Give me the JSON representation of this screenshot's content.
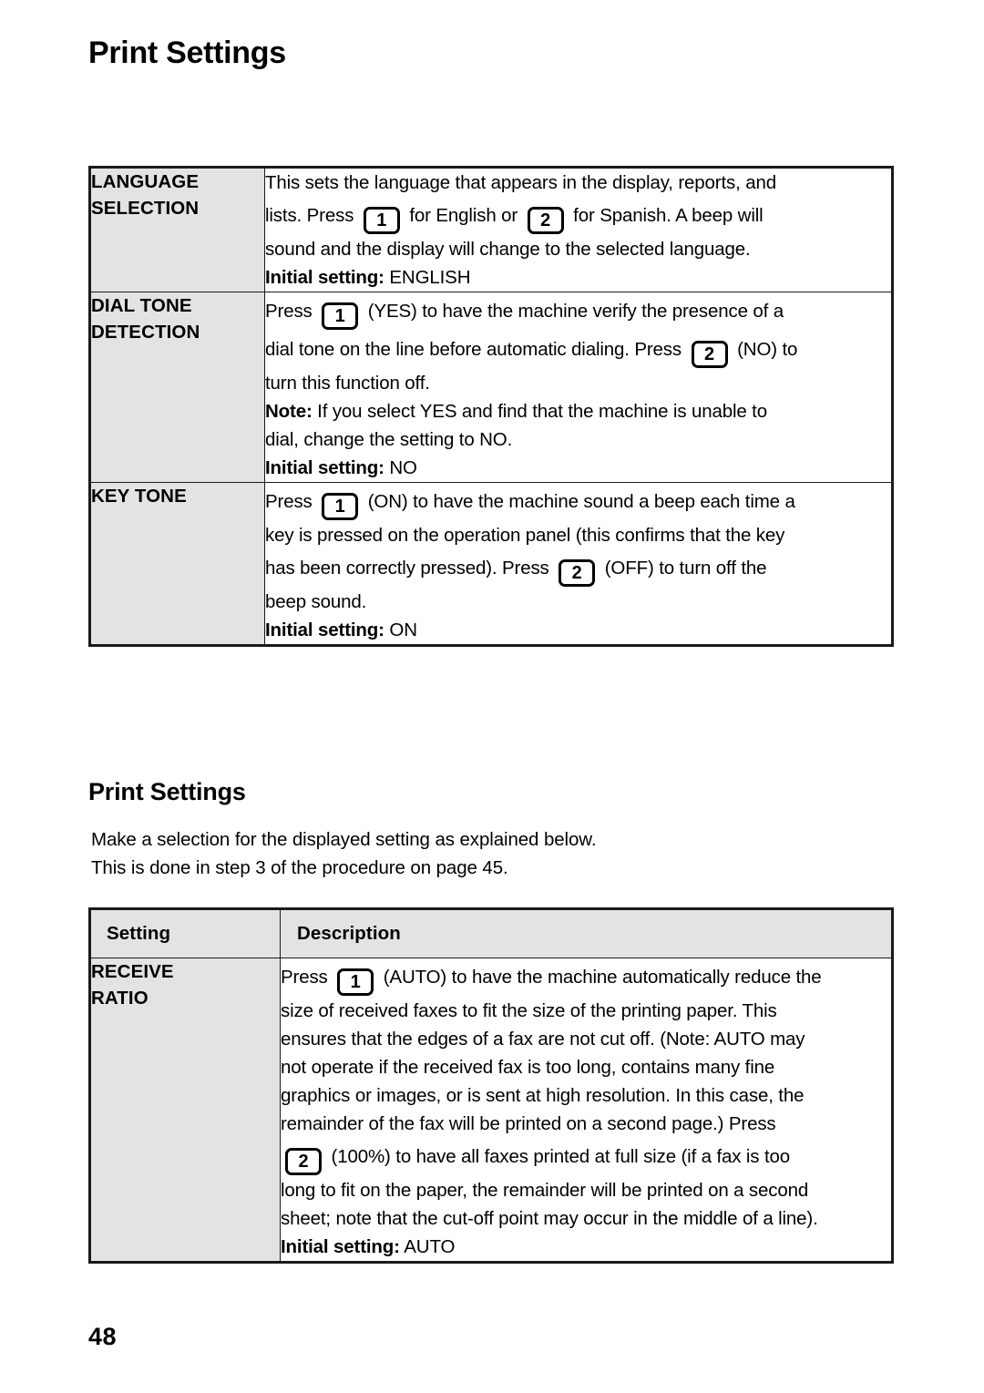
{
  "document": {
    "title": "Print Settings",
    "page_number": "48"
  },
  "settings_table": {
    "rows": [
      {
        "setting_lines": [
          "LANGUAGE",
          "SELECTION"
        ],
        "description_lines": [
          [
            {
              "t": "text",
              "v": "This sets the language that appears in the display, reports, and"
            }
          ],
          [
            {
              "t": "text",
              "v": "lists. Press "
            },
            {
              "t": "key",
              "v": "1"
            },
            {
              "t": "text",
              "v": " for English or "
            },
            {
              "t": "key",
              "v": "2"
            },
            {
              "t": "text",
              "v": " for Spanish. A beep will"
            }
          ],
          [
            {
              "t": "text",
              "v": "sound and the display will change to the selected language."
            }
          ],
          [
            {
              "t": "bold",
              "v": "Initial setting:"
            },
            {
              "t": "text",
              "v": " ENGLISH"
            }
          ]
        ]
      },
      {
        "setting_lines": [
          "DIAL TONE",
          "DETECTION"
        ],
        "description_lines": [
          [
            {
              "t": "text",
              "v": "Press "
            },
            {
              "t": "key",
              "v": "1"
            },
            {
              "t": "text",
              "v": " (YES) to have the machine verify the presence of a"
            }
          ],
          [
            {
              "t": "text",
              "v": "dial tone on the line before automatic dialing. Press "
            },
            {
              "t": "key",
              "v": "2"
            },
            {
              "t": "text",
              "v": " (NO) to"
            }
          ],
          [
            {
              "t": "text",
              "v": "turn this function off."
            }
          ],
          [
            {
              "t": "bold",
              "v": "Note:"
            },
            {
              "t": "text",
              "v": " If you select YES and find that the machine is unable to"
            }
          ],
          [
            {
              "t": "text",
              "v": "dial, change the setting to NO."
            }
          ],
          [
            {
              "t": "bold",
              "v": "Initial setting:"
            },
            {
              "t": "text",
              "v": " NO"
            }
          ]
        ]
      },
      {
        "setting_lines": [
          "KEY TONE"
        ],
        "description_lines": [
          [
            {
              "t": "text",
              "v": "Press "
            },
            {
              "t": "key",
              "v": "1"
            },
            {
              "t": "text",
              "v": " (ON) to have the machine sound a beep each time a"
            }
          ],
          [
            {
              "t": "text",
              "v": "key is pressed on the operation panel (this confirms that the key"
            }
          ],
          [
            {
              "t": "text",
              "v": "has been correctly pressed). Press "
            },
            {
              "t": "key",
              "v": "2"
            },
            {
              "t": "text",
              "v": " (OFF) to turn off the"
            }
          ],
          [
            {
              "t": "text",
              "v": "beep sound."
            }
          ],
          [
            {
              "t": "bold",
              "v": "Initial setting:"
            },
            {
              "t": "text",
              "v": " ON"
            }
          ]
        ]
      }
    ]
  },
  "print_settings_section": {
    "heading": "Print Settings",
    "intro_lines": [
      "Make a selection for the displayed setting as explained below.",
      "This is done in step 3 of the procedure on page 45."
    ],
    "table": {
      "headers": [
        "Setting",
        "Description"
      ],
      "rows": [
        {
          "setting_lines": [
            "RECEIVE",
            "RATIO"
          ],
          "description_lines": [
            [
              {
                "t": "text",
                "v": "Press "
              },
              {
                "t": "key",
                "v": "1"
              },
              {
                "t": "text",
                "v": " (AUTO) to have the machine automatically reduce the"
              }
            ],
            [
              {
                "t": "text",
                "v": "size of received faxes to fit the size of the printing paper. This"
              }
            ],
            [
              {
                "t": "text",
                "v": "ensures that the edges of a fax are not cut off. (Note: AUTO may"
              }
            ],
            [
              {
                "t": "text",
                "v": "not operate if the received fax is too long, contains many fine"
              }
            ],
            [
              {
                "t": "text",
                "v": "graphics or images, or is sent at high resolution. In this case, the"
              }
            ],
            [
              {
                "t": "text",
                "v": "remainder of the fax will be printed on a second page.) Press"
              }
            ],
            [
              {
                "t": "key",
                "v": "2"
              },
              {
                "t": "text",
                "v": " (100%) to have all faxes printed at full size (if a fax is too"
              }
            ],
            [
              {
                "t": "text",
                "v": "long to fit on the paper, the remainder will be printed on a second"
              }
            ],
            [
              {
                "t": "text",
                "v": "sheet; note that the cut-off point may occur in the middle of a line)."
              }
            ],
            [
              {
                "t": "bold",
                "v": "Initial setting:"
              },
              {
                "t": "text",
                "v": " AUTO"
              }
            ]
          ]
        }
      ]
    }
  }
}
